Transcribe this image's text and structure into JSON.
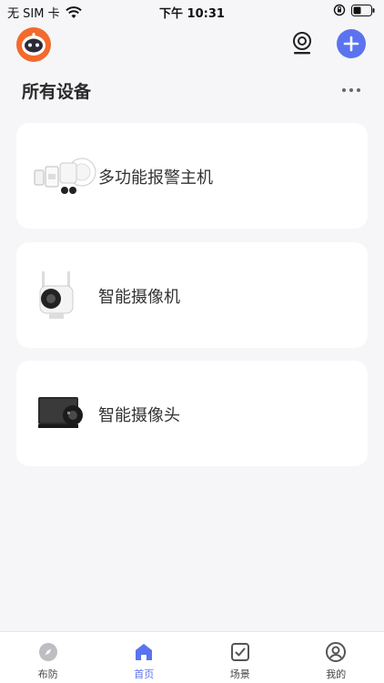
{
  "status_bar": {
    "carrier": "无 SIM 卡",
    "time": "下午 10:31"
  },
  "header": {
    "section_title": "所有设备"
  },
  "devices": [
    {
      "name": "多功能报警主机",
      "icon": "alarm-host-icon"
    },
    {
      "name": "智能摄像机",
      "icon": "camera-icon"
    },
    {
      "name": "智能摄像头",
      "icon": "camera-head-icon"
    }
  ],
  "tabs": [
    {
      "label": "布防",
      "icon": "compass-icon",
      "active": false
    },
    {
      "label": "首页",
      "icon": "home-icon",
      "active": true
    },
    {
      "label": "场景",
      "icon": "checkbox-icon",
      "active": false
    },
    {
      "label": "我的",
      "icon": "profile-icon",
      "active": false
    }
  ],
  "colors": {
    "accent": "#5b73f0",
    "avatar": "#f26a2e",
    "background": "#f6f6f8"
  }
}
